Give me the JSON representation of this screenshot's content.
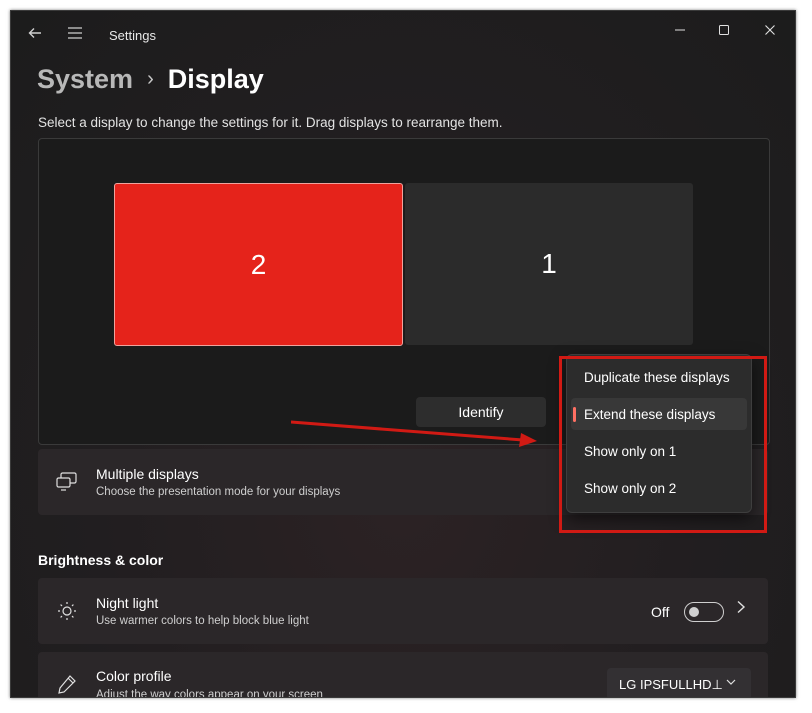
{
  "titlebar": {
    "app_title": "Settings",
    "back_icon": "back-arrow-icon",
    "menu_icon": "hamburger-menu-icon",
    "minimize_icon": "minimize-icon",
    "maximize_icon": "maximize-icon",
    "close_icon": "close-icon"
  },
  "breadcrumb": {
    "parent": "System",
    "separator": "›",
    "current": "Display"
  },
  "arrange": {
    "hint": "Select a display to change the settings for it. Drag displays to rearrange them.",
    "monitors": [
      {
        "label": "2",
        "selected": true,
        "color": "#e5231b"
      },
      {
        "label": "1",
        "selected": false,
        "color": "#2b2b2b"
      }
    ],
    "identify_label": "Identify"
  },
  "multiple_displays": {
    "title": "Multiple displays",
    "subtitle": "Choose the presentation mode for your displays",
    "icon": "multiple-displays-icon"
  },
  "dropdown": {
    "items": [
      {
        "label": "Duplicate these displays",
        "selected": false
      },
      {
        "label": "Extend these displays",
        "selected": true
      },
      {
        "label": "Show only on 1",
        "selected": false
      },
      {
        "label": "Show only on 2",
        "selected": false
      }
    ],
    "accent_color": "#ff7063"
  },
  "brightness_section": {
    "heading": "Brightness & color"
  },
  "night_light": {
    "title": "Night light",
    "subtitle": "Use warmer colors to help block blue light",
    "icon": "brightness-sun-icon",
    "toggle_label": "Off",
    "toggle_on": false,
    "chevron_icon": "chevron-right-icon"
  },
  "color_profile": {
    "title": "Color profile",
    "subtitle": "Adjust the way colors appear on your screen",
    "icon": "eyedropper-icon",
    "value": "LG IPSFULLHD⊥",
    "chevron_icon": "chevron-down-icon"
  },
  "annotation": {
    "color": "#d11a14"
  }
}
